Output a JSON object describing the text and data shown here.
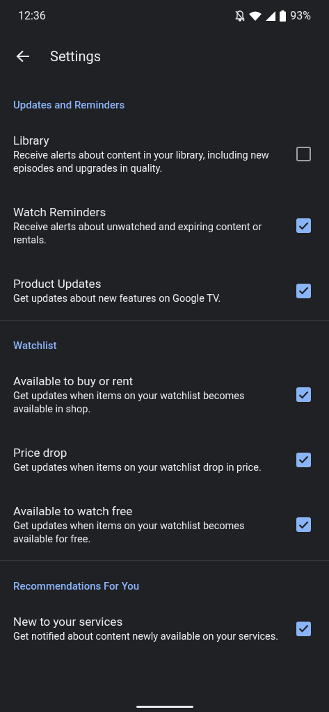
{
  "status_bar": {
    "time": "12:36",
    "battery": "93%"
  },
  "app_bar": {
    "title": "Settings"
  },
  "sections": [
    {
      "header": "Updates and Reminders",
      "items": [
        {
          "title": "Library",
          "description": "Receive alerts about content in your library, including new episodes and upgrades in quality.",
          "checked": false
        },
        {
          "title": "Watch Reminders",
          "description": "Receive alerts about unwatched and expiring content or rentals.",
          "checked": true
        },
        {
          "title": "Product Updates",
          "description": "Get updates about new features on Google TV.",
          "checked": true
        }
      ]
    },
    {
      "header": "Watchlist",
      "items": [
        {
          "title": "Available to buy or rent",
          "description": "Get updates when items on your watchlist becomes available in shop.",
          "checked": true
        },
        {
          "title": "Price drop",
          "description": "Get updates when items on your watchlist drop in price.",
          "checked": true
        },
        {
          "title": "Available to watch free",
          "description": "Get updates when items on your watchlist becomes available for free.",
          "checked": true
        }
      ]
    },
    {
      "header": "Recommendations For You",
      "items": [
        {
          "title": "New to your services",
          "description": "Get notified about content newly available on your services.",
          "checked": true
        }
      ]
    }
  ]
}
